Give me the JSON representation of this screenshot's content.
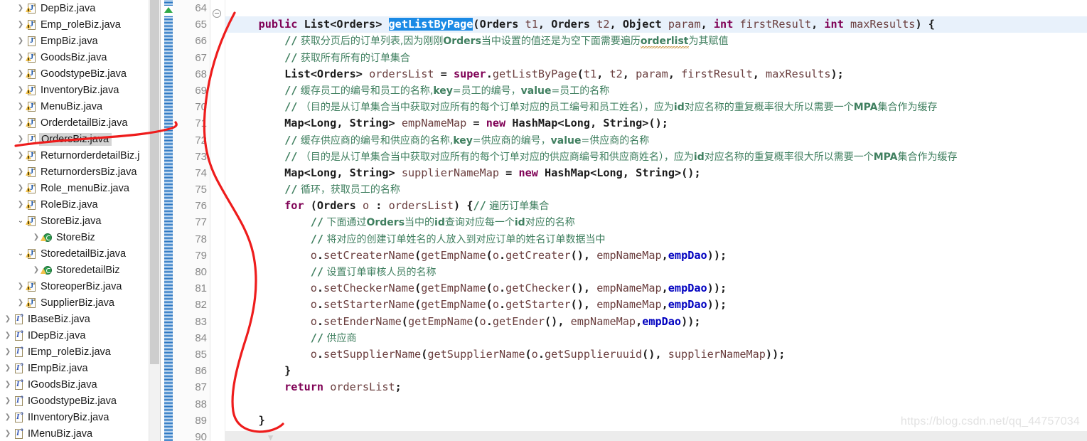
{
  "colors": {
    "selection_blue": "#1a8ae5",
    "current_line": "#e8f1fb",
    "comment_green": "#3f7f5f",
    "keyword_purple": "#7f0055",
    "field_blue": "#0000c0",
    "annotation_red": "#ee1c1c",
    "tree_selected_gray": "#d4d4d4"
  },
  "sidebar": {
    "name": "package-explorer",
    "scrollbar": {
      "thumb_top": 0,
      "thumb_height": 512
    },
    "items": [
      {
        "label": "DepBiz.java",
        "icon": "java-warning-file-icon",
        "indent": 1,
        "arrow": "collapsed",
        "selected": false
      },
      {
        "label": "Emp_roleBiz.java",
        "icon": "java-warning-file-icon",
        "indent": 1,
        "arrow": "collapsed",
        "selected": false
      },
      {
        "label": "EmpBiz.java",
        "icon": "java-file-icon",
        "indent": 1,
        "arrow": "collapsed",
        "selected": false
      },
      {
        "label": "GoodsBiz.java",
        "icon": "java-warning-file-icon",
        "indent": 1,
        "arrow": "collapsed",
        "selected": false
      },
      {
        "label": "GoodstypeBiz.java",
        "icon": "java-warning-file-icon",
        "indent": 1,
        "arrow": "collapsed",
        "selected": false
      },
      {
        "label": "InventoryBiz.java",
        "icon": "java-warning-file-icon",
        "indent": 1,
        "arrow": "collapsed",
        "selected": false
      },
      {
        "label": "MenuBiz.java",
        "icon": "java-warning-file-icon",
        "indent": 1,
        "arrow": "collapsed",
        "selected": false
      },
      {
        "label": "OrderdetailBiz.java",
        "icon": "java-warning-file-icon",
        "indent": 1,
        "arrow": "collapsed",
        "selected": false
      },
      {
        "label": "OrdersBiz.java",
        "icon": "java-file-icon",
        "indent": 1,
        "arrow": "collapsed",
        "selected": true
      },
      {
        "label": "ReturnorderdetailBiz.j",
        "icon": "java-warning-file-icon",
        "indent": 1,
        "arrow": "collapsed",
        "selected": false
      },
      {
        "label": "ReturnordersBiz.java",
        "icon": "java-warning-file-icon",
        "indent": 1,
        "arrow": "collapsed",
        "selected": false
      },
      {
        "label": "Role_menuBiz.java",
        "icon": "java-warning-file-icon",
        "indent": 1,
        "arrow": "collapsed",
        "selected": false
      },
      {
        "label": "RoleBiz.java",
        "icon": "java-warning-file-icon",
        "indent": 1,
        "arrow": "collapsed",
        "selected": false
      },
      {
        "label": "StoreBiz.java",
        "icon": "java-warning-file-icon",
        "indent": 1,
        "arrow": "expanded",
        "selected": false
      },
      {
        "label": "StoreBiz",
        "icon": "class-warning-icon",
        "indent": 2,
        "arrow": "collapsed",
        "selected": false
      },
      {
        "label": "StoredetailBiz.java",
        "icon": "java-warning-file-icon",
        "indent": 1,
        "arrow": "expanded",
        "selected": false
      },
      {
        "label": "StoredetailBiz",
        "icon": "class-warning-icon",
        "indent": 2,
        "arrow": "collapsed",
        "selected": false
      },
      {
        "label": "StoreoperBiz.java",
        "icon": "java-warning-file-icon",
        "indent": 1,
        "arrow": "collapsed",
        "selected": false
      },
      {
        "label": "SupplierBiz.java",
        "icon": "java-warning-file-icon",
        "indent": 1,
        "arrow": "collapsed",
        "selected": false
      },
      {
        "label": "IBaseBiz.java",
        "icon": "interface-file-icon",
        "indent": 0,
        "arrow": "collapsed",
        "selected": false
      },
      {
        "label": "IDepBiz.java",
        "icon": "interface-file-icon",
        "indent": 0,
        "arrow": "collapsed",
        "selected": false
      },
      {
        "label": "IEmp_roleBiz.java",
        "icon": "interface-file-icon",
        "indent": 0,
        "arrow": "collapsed",
        "selected": false
      },
      {
        "label": "IEmpBiz.java",
        "icon": "interface-file-icon",
        "indent": 0,
        "arrow": "collapsed",
        "selected": false
      },
      {
        "label": "IGoodsBiz.java",
        "icon": "interface-file-icon",
        "indent": 0,
        "arrow": "collapsed",
        "selected": false
      },
      {
        "label": "IGoodstypeBiz.java",
        "icon": "interface-file-icon",
        "indent": 0,
        "arrow": "collapsed",
        "selected": false
      },
      {
        "label": "IInventoryBiz.java",
        "icon": "interface-file-icon",
        "indent": 0,
        "arrow": "collapsed",
        "selected": false
      },
      {
        "label": "IMenuBiz.java",
        "icon": "interface-file-icon",
        "indent": 0,
        "arrow": "collapsed",
        "selected": false
      }
    ]
  },
  "editor": {
    "name": "java-source-editor",
    "current_line_number": 65,
    "selected_token": "getListByPage",
    "first_line_number": 64,
    "last_line_number": 90,
    "line_numbers": [
      64,
      65,
      66,
      67,
      68,
      69,
      70,
      71,
      72,
      73,
      74,
      75,
      76,
      77,
      78,
      79,
      80,
      81,
      82,
      83,
      84,
      85,
      86,
      87,
      88,
      89,
      90
    ],
    "folding_marker_line": 65,
    "lines": [
      {
        "n": 64,
        "text": ""
      },
      {
        "n": 65,
        "text": "    public List<Orders> getListByPage(Orders t1, Orders t2, Object param, int firstResult, int maxResults) {"
      },
      {
        "n": 66,
        "text": "        // 获取分页后的订单列表,因为刚刚Orders当中设置的值还是为空下面需要遍历orderlist为其赋值"
      },
      {
        "n": 67,
        "text": "        // 获取所有所有的订单集合"
      },
      {
        "n": 68,
        "text": "        List<Orders> ordersList = super.getListByPage(t1, t2, param, firstResult, maxResults);"
      },
      {
        "n": 69,
        "text": "        // 缓存员工的编号和员工的名称,key=员工的编号，value=员工的名称"
      },
      {
        "n": 70,
        "text": "        // （目的是从订单集合当中获取对应所有的每个订单对应的员工编号和员工姓名），应为id对应名称的重复概率很大所以需要一个MPA集合作为缓存"
      },
      {
        "n": 71,
        "text": "        Map<Long, String> empNameMap = new HashMap<Long, String>();"
      },
      {
        "n": 72,
        "text": "        // 缓存供应商的编号和供应商的名称,key=供应商的编号，value=供应商的名称"
      },
      {
        "n": 73,
        "text": "        // （目的是从订单集合当中获取对应所有的每个订单对应的供应商编号和供应商姓名），应为id对应名称的重复概率很大所以需要一个MPA集合作为缓存"
      },
      {
        "n": 74,
        "text": "        Map<Long, String> supplierNameMap = new HashMap<Long, String>();"
      },
      {
        "n": 75,
        "text": "        // 循环，获取员工的名称"
      },
      {
        "n": 76,
        "text": "        for (Orders o : ordersList) {// 遍历订单集合"
      },
      {
        "n": 77,
        "text": "            // 下面通过Orders当中的id查询对应每一个id对应的名称"
      },
      {
        "n": 78,
        "text": "            // 将对应的创建订单姓名的人放入到对应订单的姓名订单数据当中"
      },
      {
        "n": 79,
        "text": "            o.setCreaterName(getEmpName(o.getCreater(), empNameMap,empDao));"
      },
      {
        "n": 80,
        "text": "            // 设置订单审核人员的名称"
      },
      {
        "n": 81,
        "text": "            o.setCheckerName(getEmpName(o.getChecker(), empNameMap,empDao));"
      },
      {
        "n": 82,
        "text": "            o.setStarterName(getEmpName(o.getStarter(), empNameMap,empDao));"
      },
      {
        "n": 83,
        "text": "            o.setEnderName(getEmpName(o.getEnder(), empNameMap,empDao));"
      },
      {
        "n": 84,
        "text": "            // 供应商"
      },
      {
        "n": 85,
        "text": "            o.setSupplierName(getSupplierName(o.getSupplieruuid(), supplierNameMap));"
      },
      {
        "n": 86,
        "text": "        }"
      },
      {
        "n": 87,
        "text": "        return ordersList;"
      },
      {
        "n": 88,
        "text": ""
      },
      {
        "n": 89,
        "text": "    }"
      },
      {
        "n": 90,
        "text": ""
      }
    ]
  },
  "watermark": {
    "text": "https://blog.csdn.net/qq_44757034"
  },
  "annotation": {
    "name": "red-curve-annotation",
    "color": "#ee1c1c"
  }
}
